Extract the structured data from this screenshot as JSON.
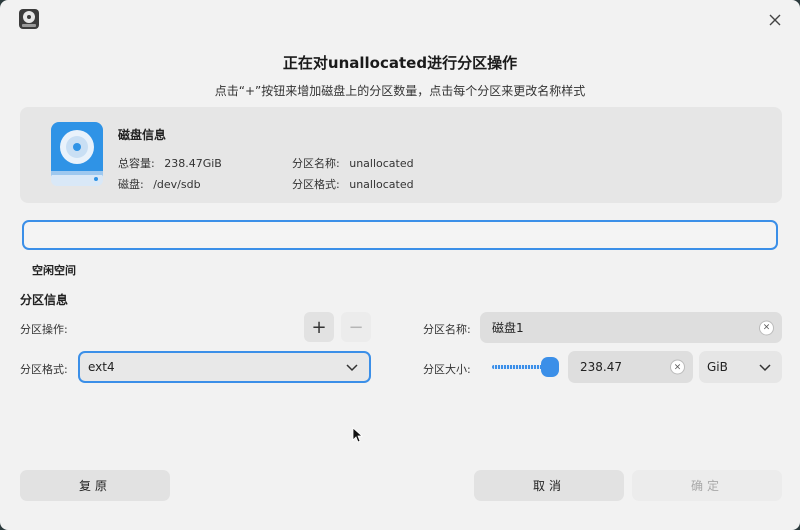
{
  "dialog": {
    "title": "正在对unallocated进行分区操作",
    "subtitle": "点击“+”按钮来增加磁盘上的分区数量，点击每个分区来更改名称样式"
  },
  "disk": {
    "name": "磁盘信息",
    "total_label": "总容量:",
    "total_value": "238.47GiB",
    "device_label": "磁盘:",
    "device_value": "/dev/sdb",
    "part_name_label": "分区名称:",
    "part_name_value": "unallocated",
    "part_format_label": "分区格式:",
    "part_format_value": "unallocated"
  },
  "bar": {
    "free_label": "空闲空间"
  },
  "partition": {
    "section_title": "分区信息",
    "op_label": "分区操作:",
    "add_symbol": "+",
    "remove_symbol": "−",
    "name_label": "分区名称:",
    "name_value": "磁盘1",
    "format_label": "分区格式:",
    "format_value": "ext4",
    "size_label": "分区大小:",
    "size_value": "238.47",
    "unit_value": "GiB",
    "slider_fraction": 1.0
  },
  "buttons": {
    "revert": "复原",
    "cancel": "取消",
    "confirm": "确定"
  },
  "icons": {
    "close": "close-icon",
    "clear": "clear-icon",
    "chevron": "chevron-down-icon",
    "disk": "disk-icon"
  },
  "colors": {
    "accent": "#3b8fe8",
    "disk_icon": "#2f93e6"
  }
}
